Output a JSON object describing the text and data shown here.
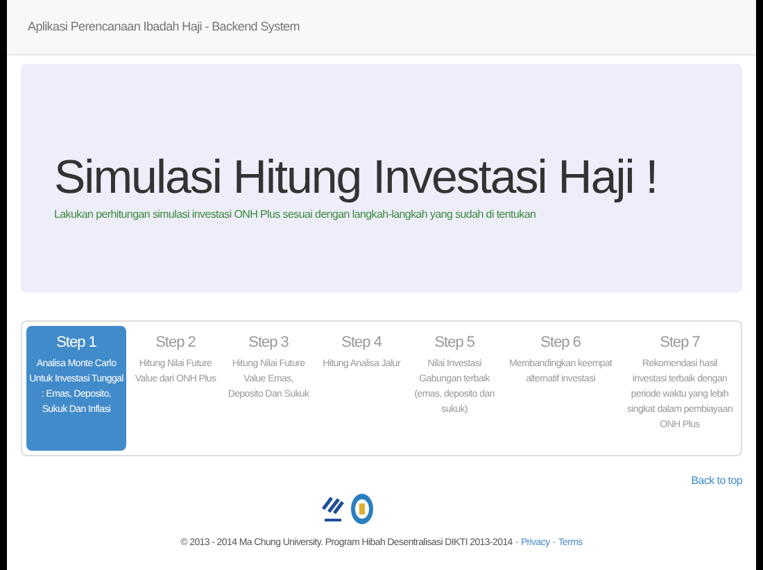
{
  "navbar": {
    "brand": "Aplikasi Perencanaan Ibadah Haji - Backend System"
  },
  "hero": {
    "title": "Simulasi Hitung Investasi Haji !",
    "subtitle": "Lakukan perhitungan simulasi investasi ONH Plus sesuai dengan langkah-langkah yang sudah di tentukan"
  },
  "steps": [
    {
      "label": "Step 1",
      "description": "Analisa Monte Carlo Untuk Investasi Tunggal : Emas, Deposito, Sukuk Dan Inflasi",
      "selected": true
    },
    {
      "label": "Step 2",
      "description": "Hitung Nilai Future Value dari ONH Plus",
      "selected": false
    },
    {
      "label": "Step 3",
      "description": "Hitung Nilai Future Value Emas, Deposito Dan Sukuk",
      "selected": false
    },
    {
      "label": "Step 4",
      "description": "Hitung Analisa Jalur",
      "selected": false
    },
    {
      "label": "Step 5",
      "description": "Nilai Investasi Gabungan terbaik (emas, deposito dan sukuk)",
      "selected": false
    },
    {
      "label": "Step 6",
      "description": "Membandingkan keempat alternatif investasi",
      "selected": false
    },
    {
      "label": "Step 7",
      "description": "Rekomendasi hasil investasi terbaik dengan periode waktu yang lebih singkat dalam pembiayaan ONH Plus",
      "selected": false
    }
  ],
  "footer": {
    "back_to_top": "Back to top",
    "copyright": "© 2013 - 2014 Ma Chung University. Program Hibah Desentralisasi DIKTI 2013-2014",
    "links": [
      {
        "separator": "·",
        "label": "Privacy"
      },
      {
        "separator": "·",
        "label": "Terms"
      }
    ]
  }
}
